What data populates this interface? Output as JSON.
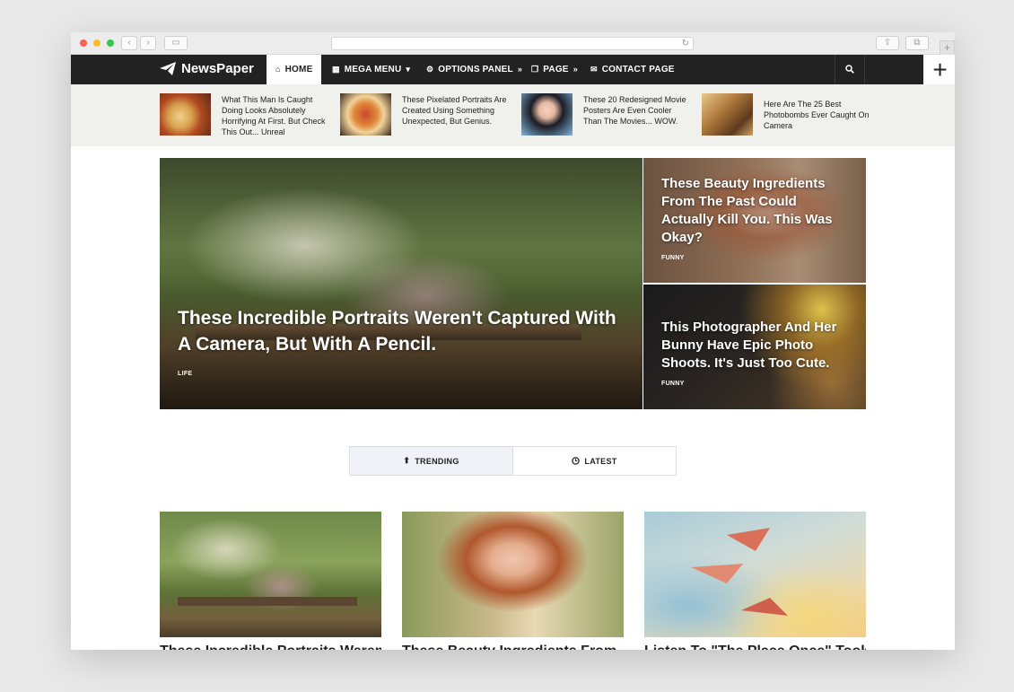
{
  "brand": {
    "name": "NewsPaper"
  },
  "nav": {
    "items": [
      {
        "label": "HOME",
        "icon": "home-icon"
      },
      {
        "label": "MEGA MENU",
        "icon": "grid-icon"
      },
      {
        "label": "OPTIONS PANEL",
        "icon": "gear-icon"
      },
      {
        "label": "PAGE",
        "icon": "pages-icon"
      },
      {
        "label": "CONTACT PAGE",
        "icon": "envelope-icon"
      }
    ]
  },
  "ticker": [
    {
      "title": "What This Man Is Caught Doing Looks Absolutely Horrifying At First. But Check This Out... Unreal",
      "image": "pizza-slice-photo"
    },
    {
      "title": "These Pixelated Portraits Are Created Using Something Unexpected, But Genius.",
      "image": "pizza-photo"
    },
    {
      "title": "These 20 Redesigned Movie Posters Are Even Cooler Than The Movies... WOW.",
      "image": "girl-portrait-photo"
    },
    {
      "title": "Here Are The 25 Best Photobombs Ever Caught On Camera",
      "image": "living-room-photo"
    }
  ],
  "hero": {
    "main": {
      "title": "These Incredible Portraits Weren't Captured With A Camera, But With A Pencil.",
      "category": "LIFE"
    },
    "side": [
      {
        "title": "These Beauty Ingredients From The Past Could Actually Kill You. This Was Okay?",
        "category": "FUNNY"
      },
      {
        "title": "This Photographer And Her Bunny Have Epic Photo Shoots. It's Just Too Cute.",
        "category": "FUNNY"
      }
    ]
  },
  "tabs": [
    {
      "label": "TRENDING",
      "icon": "flame-icon"
    },
    {
      "label": "LATEST",
      "icon": "clock-icon"
    }
  ],
  "cards": [
    {
      "title": "These Incredible Portraits Weren't",
      "image": "couple-bench-photo"
    },
    {
      "title": "These Beauty Ingredients From",
      "image": "woman-portrait-photo"
    },
    {
      "title": "Listen To \"The Place Once\" Took",
      "image": "paper-planes-photo"
    }
  ],
  "colors": {
    "nav_bg": "#222222",
    "ticker_bg": "#f0f1ec",
    "accent": "#ffffff"
  }
}
